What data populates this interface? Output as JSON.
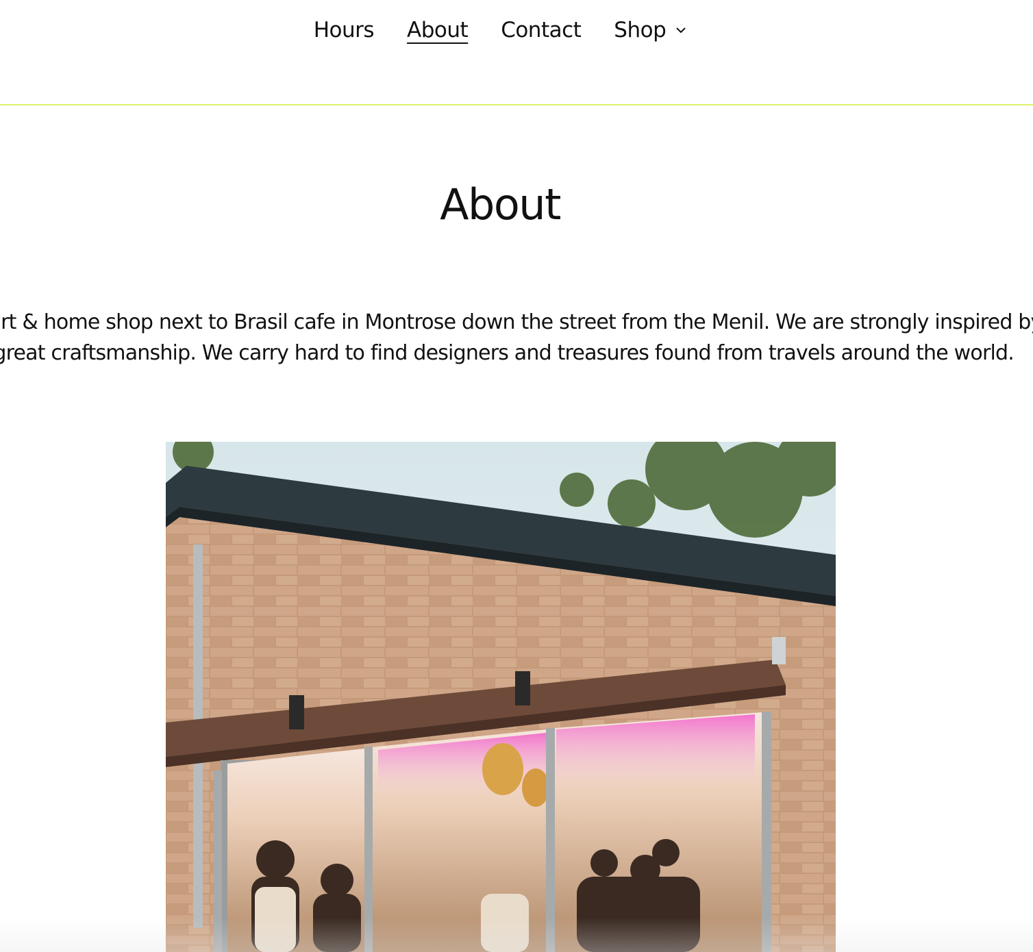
{
  "nav": {
    "items": [
      {
        "label": "Hours"
      },
      {
        "label": "About",
        "active": true
      },
      {
        "label": "Contact"
      },
      {
        "label": "Shop",
        "icon": "chevron-down-icon"
      }
    ]
  },
  "page": {
    "title": "About",
    "intro_line1": "n apparel, art & home shop next to Brasil cafe in Montrose down the street from the Menil. We are strongly inspired by f",
    "intro_line2": "lusivity, and great craftsmanship. We carry hard to find designers and treasures found from travels around the world."
  },
  "colors": {
    "header_rule": "#dff06a",
    "text": "#111111",
    "background": "#ffffff"
  }
}
